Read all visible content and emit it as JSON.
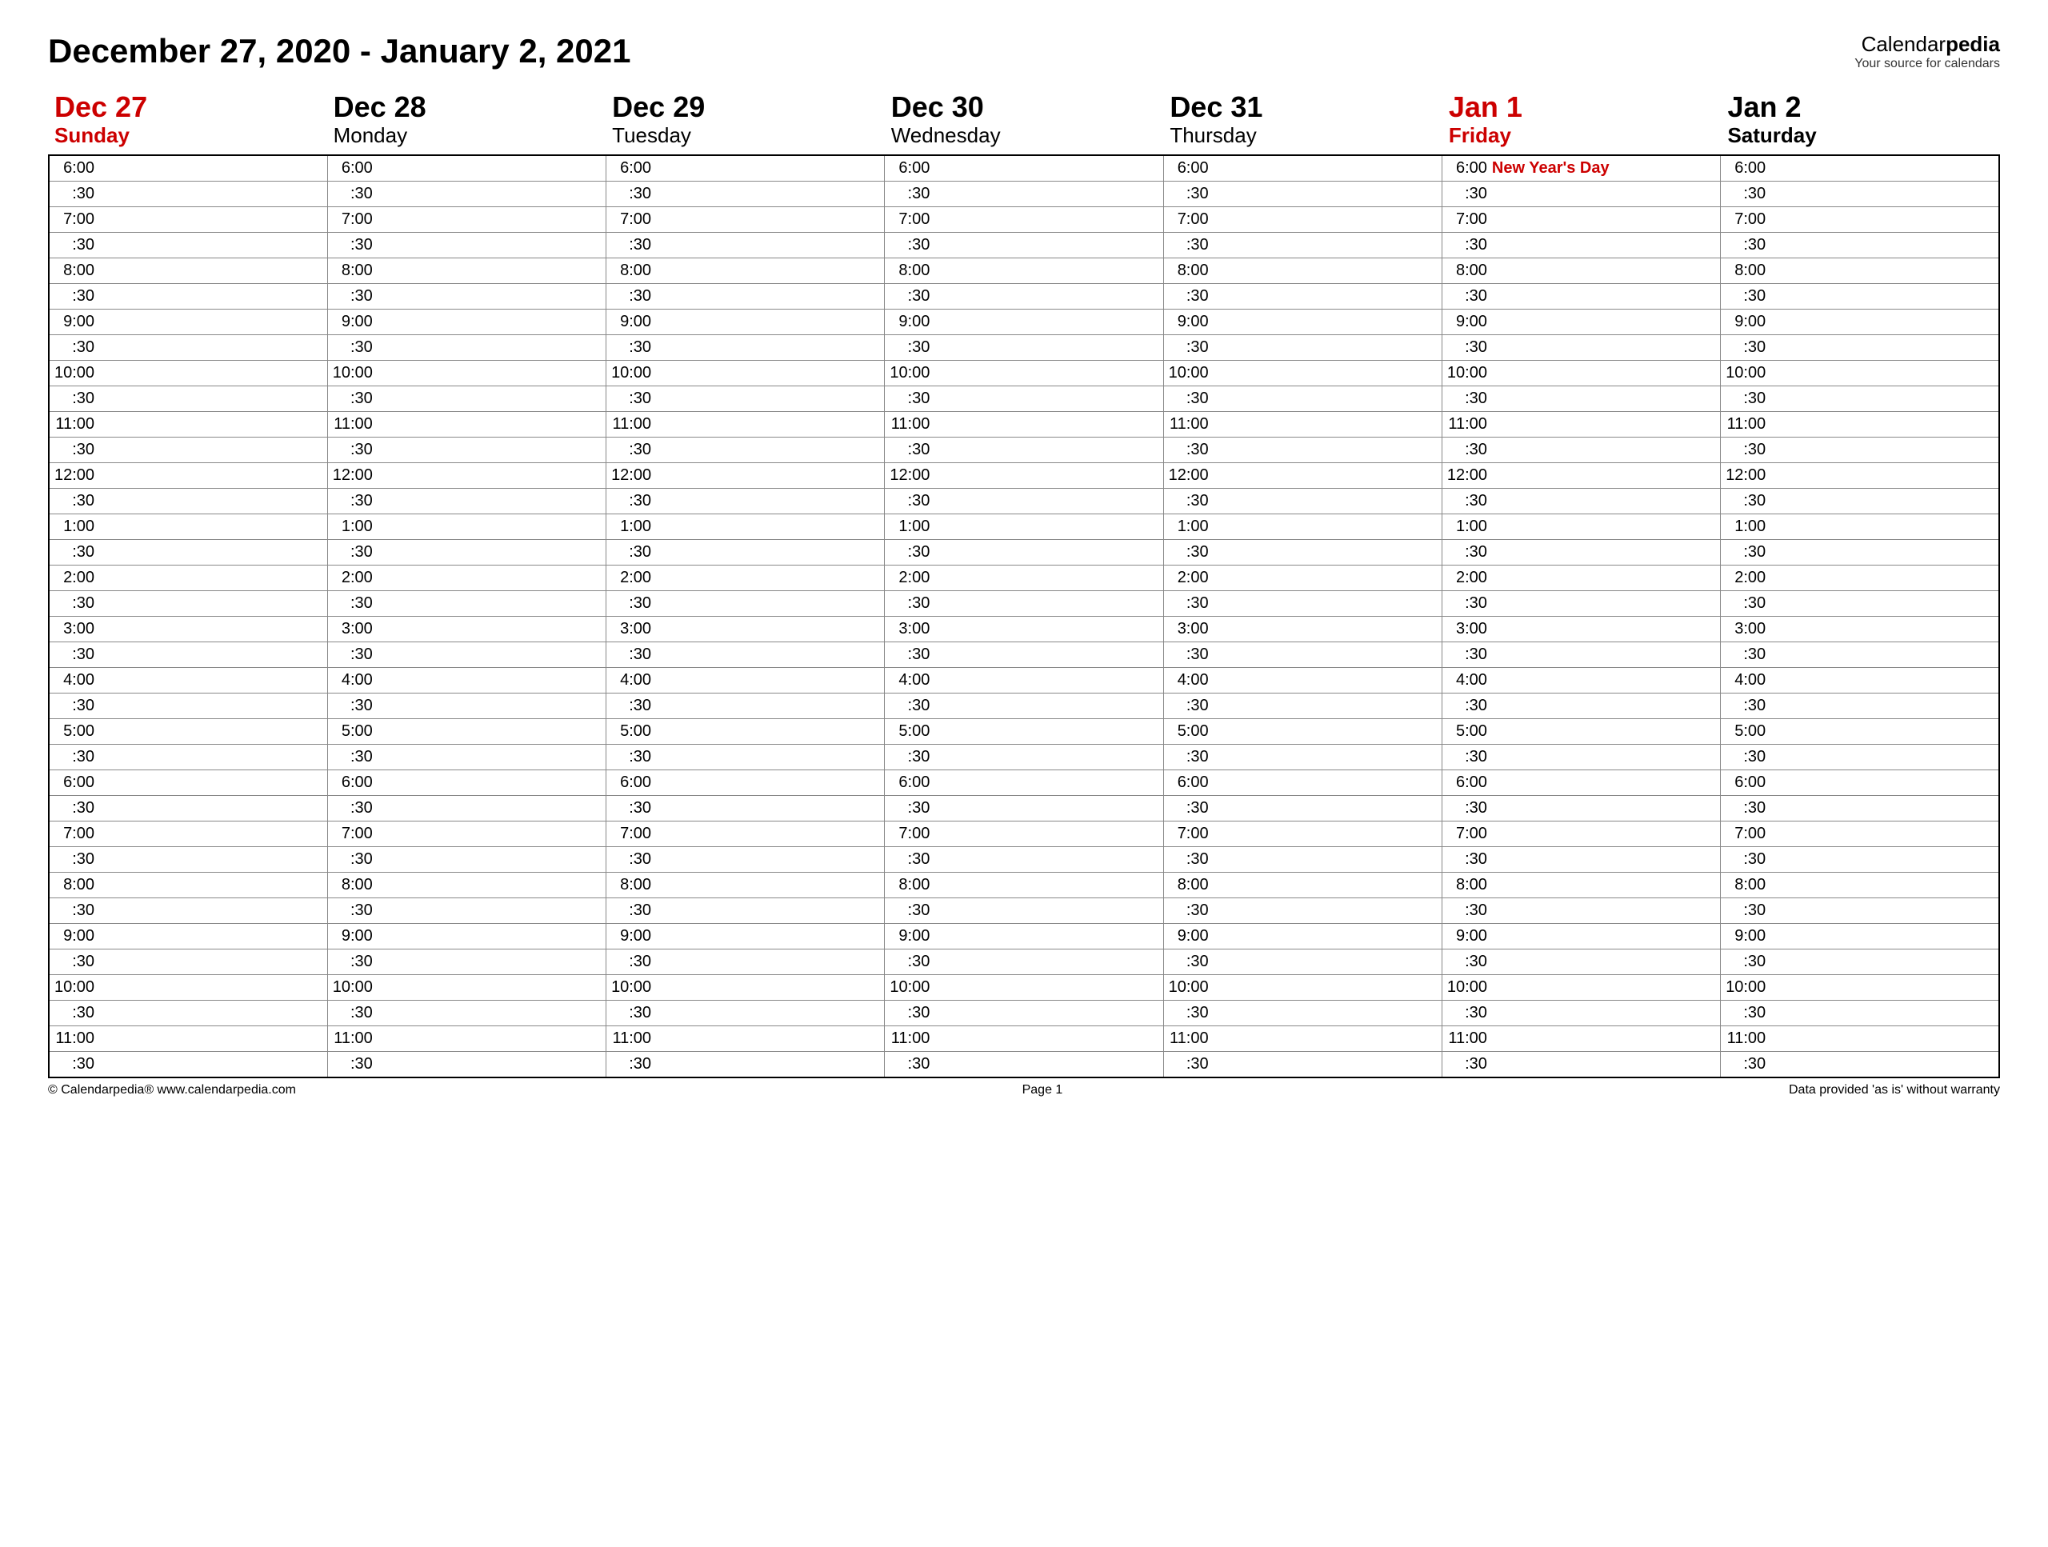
{
  "title": "December 27, 2020 - January 2, 2021",
  "brand": {
    "name_prefix": "Calendar",
    "name_suffix": "pedia",
    "tagline": "Your source for calendars"
  },
  "days": [
    {
      "short": "Dec 27",
      "name": "Sunday",
      "red": true,
      "bold": true
    },
    {
      "short": "Dec 28",
      "name": "Monday",
      "red": false,
      "bold": false
    },
    {
      "short": "Dec 29",
      "name": "Tuesday",
      "red": false,
      "bold": false
    },
    {
      "short": "Dec 30",
      "name": "Wednesday",
      "red": false,
      "bold": false
    },
    {
      "short": "Dec 31",
      "name": "Thursday",
      "red": false,
      "bold": false
    },
    {
      "short": "Jan 1",
      "name": "Friday",
      "red": true,
      "bold": true
    },
    {
      "short": "Jan 2",
      "name": "Saturday",
      "red": false,
      "bold": true
    }
  ],
  "time_slots": [
    "6:00",
    ":30",
    "7:00",
    ":30",
    "8:00",
    ":30",
    "9:00",
    ":30",
    "10:00",
    ":30",
    "11:00",
    ":30",
    "12:00",
    ":30",
    "1:00",
    ":30",
    "2:00",
    ":30",
    "3:00",
    ":30",
    "4:00",
    ":30",
    "5:00",
    ":30",
    "6:00",
    ":30",
    "7:00",
    ":30",
    "8:00",
    ":30",
    "9:00",
    ":30",
    "10:00",
    ":30",
    "11:00",
    ":30"
  ],
  "events": [
    {
      "day_index": 5,
      "slot_index": 0,
      "label": "New Year's Day"
    }
  ],
  "footer": {
    "left": "© Calendarpedia®   www.calendarpedia.com",
    "center": "Page 1",
    "right": "Data provided 'as is' without warranty"
  }
}
